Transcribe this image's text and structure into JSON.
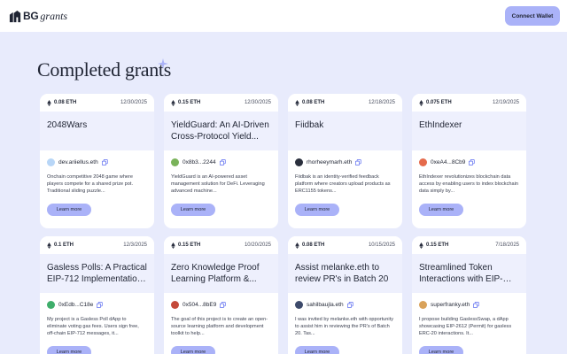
{
  "app": {
    "logo_bg": "BG",
    "logo_grants": "grants",
    "connect_label": "Connect Wallet"
  },
  "page": {
    "title": "Completed grants"
  },
  "colors": {
    "accent": "#aab2f8",
    "background": "#e8ebfc",
    "title_band": "#eef0fd"
  },
  "cards": [
    {
      "amount": "0.08 ETH",
      "date": "12/30/2025",
      "title": "2048Wars",
      "builder": "dev.ariiellus.eth",
      "avatar_color": "#b8d6f7",
      "description": "Onchain competitive 2048 game where players compete for a shared prize pot. Traditional sliding puzzle...",
      "button": "Learn more"
    },
    {
      "amount": "0.15 ETH",
      "date": "12/30/2025",
      "title": "YieldGuard: An AI-Driven Cross-Protocol Yield...",
      "builder": "0x8b3...2244",
      "avatar_color": "#7ab35a",
      "description": "YieldGuard is an AI-powered asset management solution for DeFi. Leveraging advanced machine...",
      "button": "Learn more"
    },
    {
      "amount": "0.08 ETH",
      "date": "12/18/2025",
      "title": "Fiidbak",
      "builder": "rhorheeymarh.eth",
      "avatar_color": "#2a2f3d",
      "description": "Fiidbak is an identity-verified feedback platform where creators upload products as ERC1155 tokens...",
      "button": "Learn more"
    },
    {
      "amount": "0.075 ETH",
      "date": "12/19/2025",
      "title": "EthIndexer",
      "builder": "0xeA4...8Cb9",
      "avatar_color": "#e56b4c",
      "description": "EthIndexer revolutionizes blockchain data access by enabling users to index blockchain data simply by...",
      "button": "Learn more"
    },
    {
      "amount": "0.1 ETH",
      "date": "12/3/2025",
      "title": "Gasless Polls: A Practical EIP-712 Implementation f...",
      "builder": "0xEdb...C18e",
      "avatar_color": "#3fae6b",
      "description": "My project is a Gasless Poll dApp to eliminate voting gas fees. Users sign free, off-chain EIP-712 messages, it...",
      "button": "Learn more"
    },
    {
      "amount": "0.15 ETH",
      "date": "10/20/2025",
      "title": "Zero Knowledge Proof Learning Platform &...",
      "builder": "0x504...8bE9",
      "avatar_color": "#c44a3a",
      "description": "The goal of this project is to create an open-source learning platform and development toolkit to help...",
      "button": "Learn more"
    },
    {
      "amount": "0.08 ETH",
      "date": "10/15/2025",
      "title": "Assist melanke.eth to review PR's in Batch 20",
      "builder": "sahilbaujla.eth",
      "avatar_color": "#3d4a6b",
      "description": "I was invited by melanke.eth with opportunity to assist him in reviewing the PR's of Batch 20. Tas...",
      "button": "Learn more"
    },
    {
      "amount": "0.15 ETH",
      "date": "7/18/2025",
      "title": "Streamlined Token Interactions with EIP-2612",
      "builder": "superfranky.eth",
      "avatar_color": "#d9a25a",
      "description": "I propose building GaslessSwap, a dApp showcasing EIP-2612 (Permit) for gasless ERC-20 interactions. It...",
      "button": "Learn more"
    }
  ]
}
